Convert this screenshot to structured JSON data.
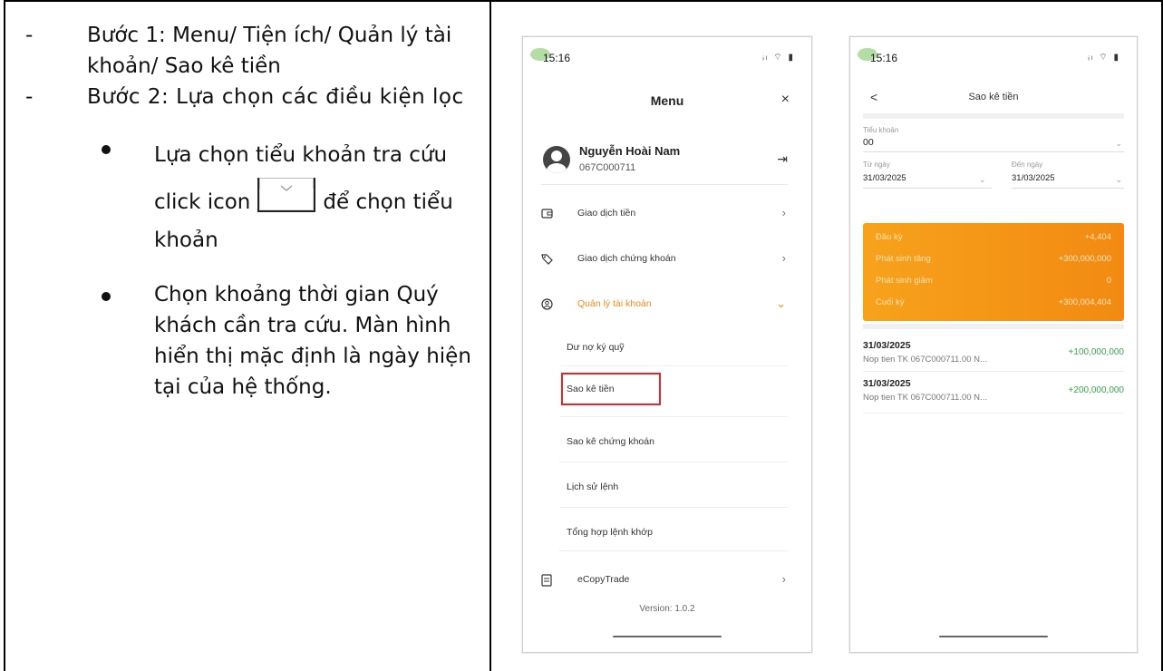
{
  "instructions": {
    "step1_dash": "-",
    "step1": "Bước 1: Menu/ Tiện ích/ Quản lý tài khoản/ Sao kê tiền",
    "step2_dash": "-",
    "step2": "Bước 2: Lựa chọn các điều kiện lọc",
    "bullet1_before": "Lựa chọn tiểu khoản tra cứu click icon",
    "bullet1_after": "để chọn tiểu khoản",
    "bullet2": "Chọn khoảng thời gian Quý khách cần tra cứu. Màn hình hiển thị mặc định là ngày hiện tại của hệ thống."
  },
  "menu_screen": {
    "time": "15:16",
    "status_icons": "ᵢₗ ⌔ ▮",
    "title": "Menu",
    "close": "×",
    "user_name": "Nguyễn Hoài Nam",
    "account": "067C000711",
    "logout": "⇥",
    "items": [
      {
        "label": "Giao dịch tiền",
        "icon": "wallet-icon"
      },
      {
        "label": "Giao dịch chứng khoán",
        "icon": "tag-icon"
      },
      {
        "label": "Quản lý tài khoản",
        "icon": "account-icon"
      },
      {
        "label": "eCopyTrade",
        "icon": "document-icon"
      }
    ],
    "sub_items": [
      "Dư nợ ký quỹ",
      "Sao kê tiền",
      "Sao kê chứng khoán",
      "Lịch sử lệnh",
      "Tổng hợp lệnh khớp"
    ],
    "version": "Version: 1.0.2",
    "highlight_color": "#e0262b",
    "accent": "#f28c1c"
  },
  "statement_screen": {
    "time": "15:16",
    "status_icons": "ᵢₗ ⌔ ▮",
    "back": "<",
    "title": "Sao kê tiền",
    "subaccount_label": "Tiểu khoản",
    "subaccount_value": "00",
    "from_label": "Từ ngày",
    "from_value": "31/03/2025",
    "to_label": "Đến ngày",
    "to_value": "31/03/2025",
    "summary": [
      {
        "label": "Đầu kỳ",
        "value": "+4,404"
      },
      {
        "label": "Phát sinh tăng",
        "value": "+300,000,000"
      },
      {
        "label": "Phát sinh giảm",
        "value": "0"
      },
      {
        "label": "Cuối kỳ",
        "value": "+300,004,404"
      }
    ],
    "transactions": [
      {
        "date": "31/03/2025",
        "note": "Nop tien TK 067C000711.00 N...",
        "amount": "+100,000,000"
      },
      {
        "date": "31/03/2025",
        "note": "Nop tien TK 067C000711.00 N...",
        "amount": "+200,000,000"
      }
    ],
    "card_color": "#f59a1a",
    "amount_color": "#3aa64a"
  }
}
